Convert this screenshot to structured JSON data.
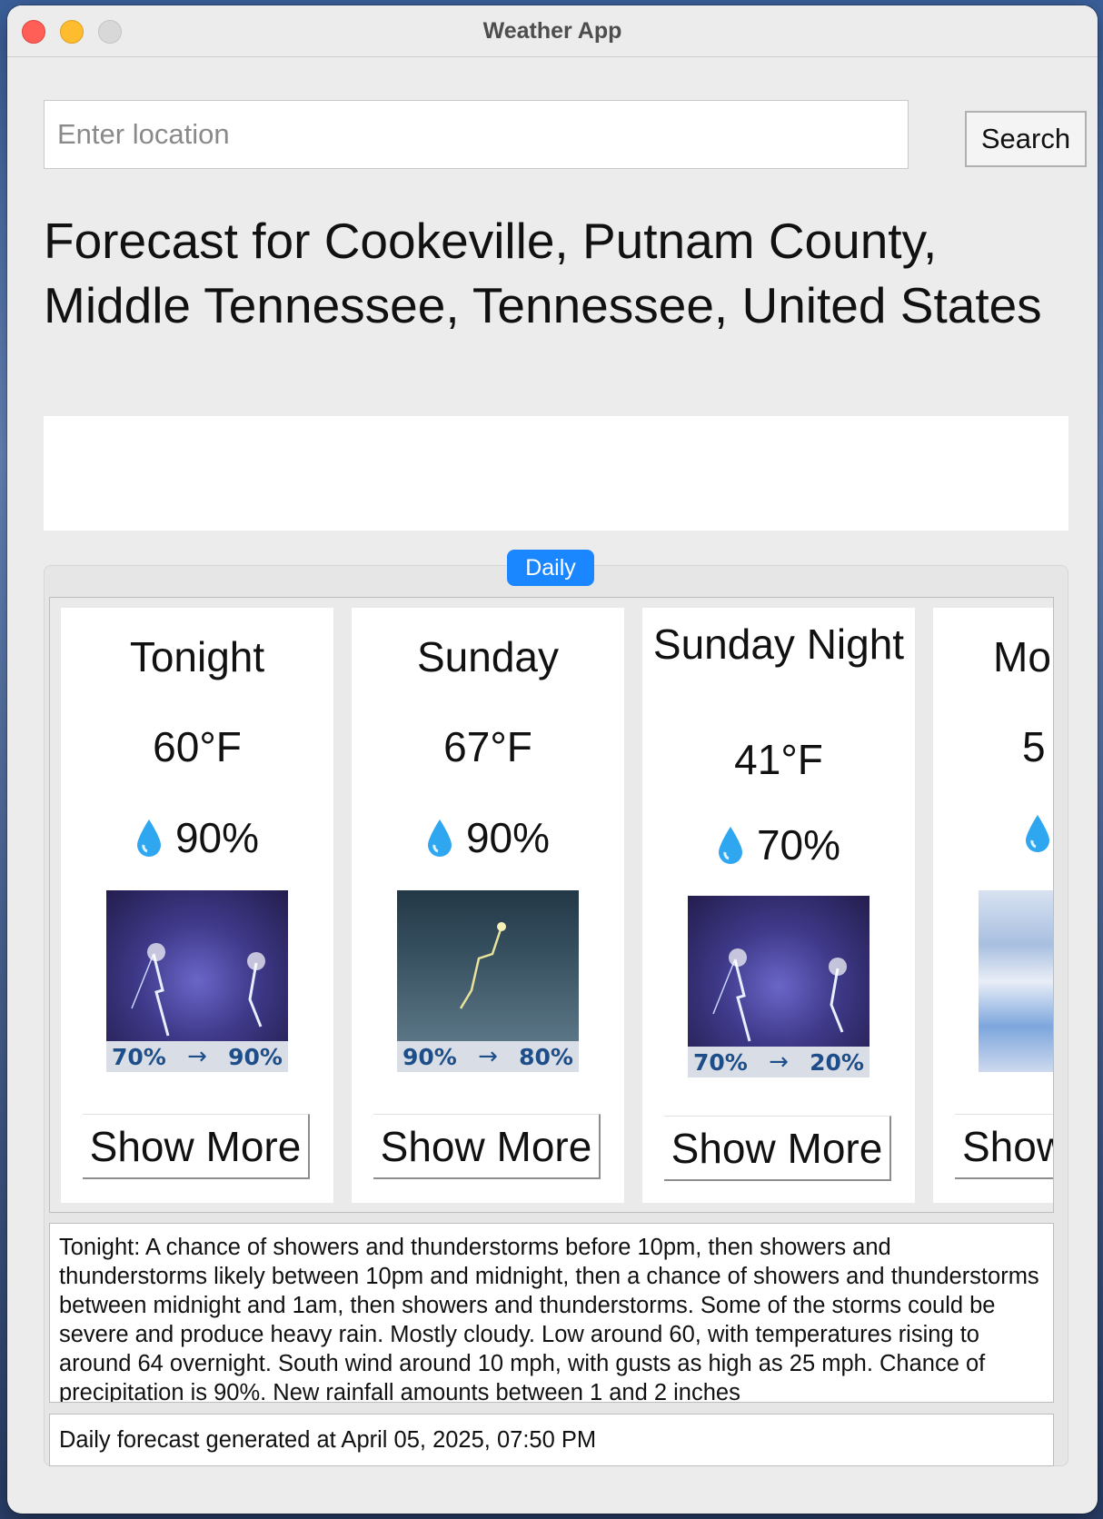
{
  "window": {
    "title": "Weather App"
  },
  "search": {
    "placeholder": "Enter location",
    "value": "",
    "button_label": "Search"
  },
  "forecast_heading": "Forecast for Cookeville, Putnam County, Middle Tennessee, Tennessee, United States",
  "tab": {
    "label": "Daily"
  },
  "cards": [
    {
      "period": "Tonight",
      "temp": "60°F",
      "precip": "90%",
      "image": "thunderstorm",
      "img_from": "70%",
      "img_to": "90%",
      "button": "Show More"
    },
    {
      "period": "Sunday",
      "temp": "67°F",
      "precip": "90%",
      "image": "rain-thunder",
      "img_from": "90%",
      "img_to": "80%",
      "button": "Show More"
    },
    {
      "period": "Sunday Night",
      "temp": "41°F",
      "precip": "70%",
      "image": "thunderstorm",
      "img_from": "70%",
      "img_to": "20%",
      "button": "Show More"
    },
    {
      "period": "Mo",
      "temp": "5",
      "precip": "",
      "image": "cloudy",
      "img_from": "",
      "img_to": "",
      "button": "Show"
    }
  ],
  "detail_text": "Tonight: A chance of showers and thunderstorms before 10pm, then showers and thunderstorms likely between 10pm and midnight, then a chance of showers and thunderstorms between midnight and 1am, then showers and thunderstorms. Some of the storms could be severe and produce heavy rain. Mostly cloudy. Low around 60, with temperatures rising to around 64 overnight. South wind around 10 mph, with gusts as high as 25 mph. Chance of precipitation is 90%. New rainfall amounts between 1 and 2 inches",
  "footer_text": "Daily forecast generated at April 05, 2025, 07:50 PM",
  "colors": {
    "tab_accent": "#1a86ff",
    "window_bg": "#ececec"
  },
  "icons": {
    "precip": "water-drop-icon"
  }
}
